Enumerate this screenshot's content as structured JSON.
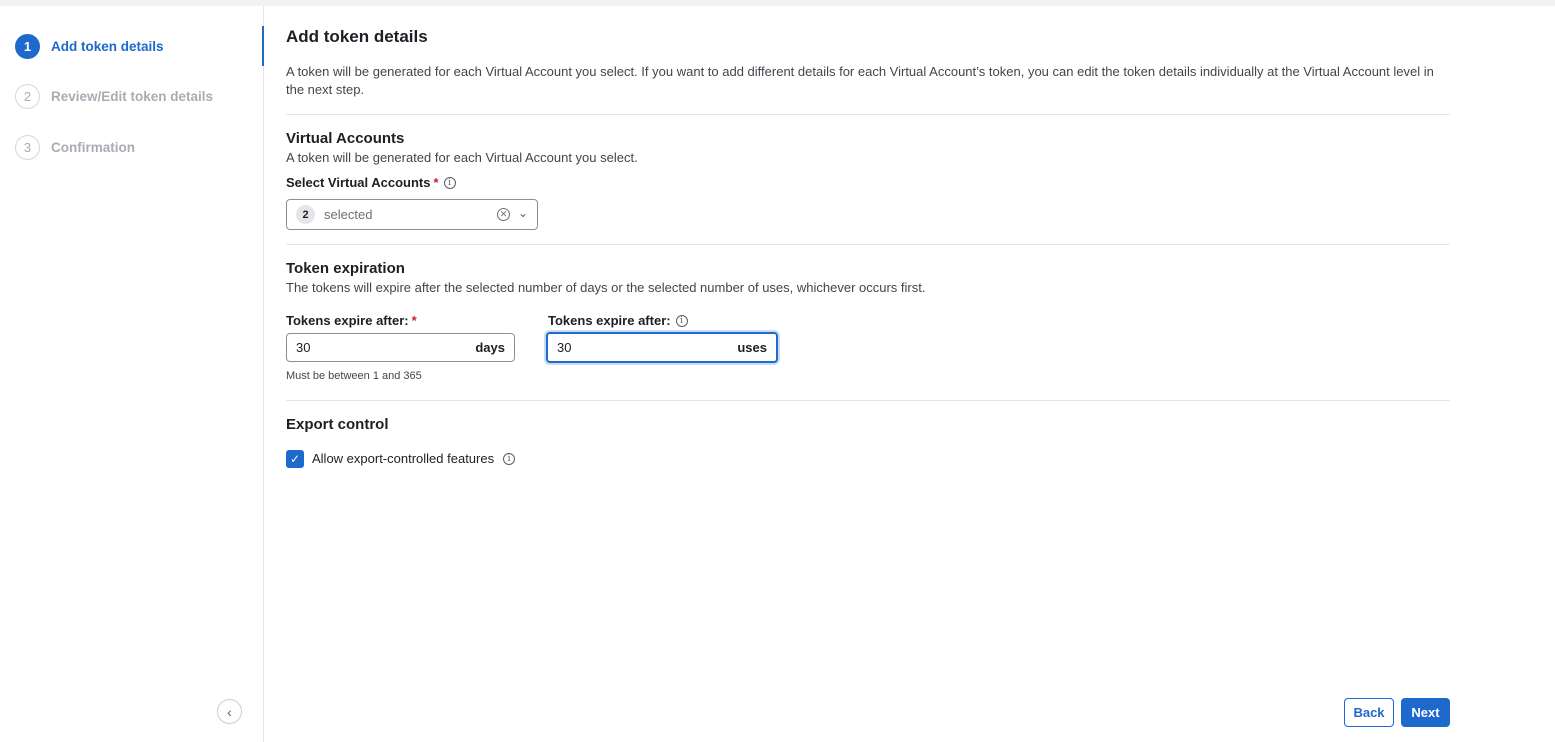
{
  "stepper": {
    "steps": [
      {
        "number": "1",
        "label": "Add token details",
        "state": "active"
      },
      {
        "number": "2",
        "label": "Review/Edit token details",
        "state": "inactive"
      },
      {
        "number": "3",
        "label": "Confirmation",
        "state": "inactive"
      }
    ],
    "collapse_icon": "chevron-left-icon"
  },
  "main": {
    "title": "Add token details",
    "intro": "A token will be generated for each Virtual Account you select. If you want to add different details for each Virtual Account’s token, you can edit the token details individually at the Virtual Account level in the next step.",
    "virtual_accounts": {
      "title": "Virtual Accounts",
      "description": "A token will be generated for each Virtual Account you select.",
      "field_label": "Select Virtual Accounts",
      "required_mark": "*",
      "selected_count": "2",
      "selected_text": "selected"
    },
    "token_expiration": {
      "title": "Token expiration",
      "description": "The tokens will expire after the selected number of days or the selected number of uses, whichever occurs first.",
      "days_label": "Tokens expire after:",
      "days_required_mark": "*",
      "days_value": "30",
      "days_unit": "days",
      "days_helper": "Must be between 1 and 365",
      "uses_label": "Tokens expire after:",
      "uses_value": "30",
      "uses_unit": "uses"
    },
    "export_control": {
      "title": "Export control",
      "checkbox_label": "Allow export-controlled features",
      "checked": true
    }
  },
  "footer": {
    "back_label": "Back",
    "next_label": "Next"
  },
  "colors": {
    "accent": "#1d69cc",
    "required": "#cc1f2e",
    "inactive_text": "#a8adb4"
  }
}
